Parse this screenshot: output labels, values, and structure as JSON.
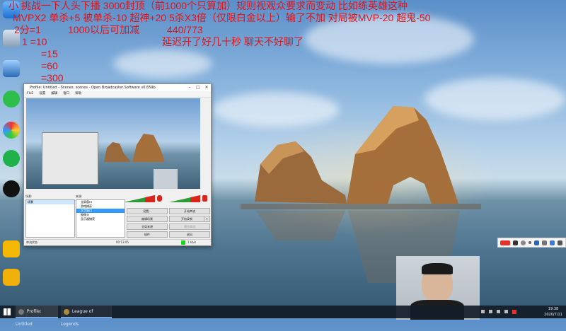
{
  "overlay": {
    "line1": "小 挑战一下人头下播 3000封顶（前1000个只算加）规则视观众要求而变动 比如练英雄这种",
    "line2": "MVPX2 单杀+5 被单杀-10 超神+20 5杀X3倍（仅限白金以上）输了不加 对局被MVP-20 超鬼-50",
    "line3a": "2分=1",
    "line3b": "1000以后可加减",
    "line3c": "440/773",
    "line4a": "1 =10",
    "line4b": "延迟开了好几十秒 聊天不好聊了",
    "line5": "=15",
    "line6": "=60",
    "line7": "=300"
  },
  "obs": {
    "title": "Profile: Untitled - Scenes: scenes - Open Broadcaster Software v0.659b",
    "menu": [
      "FILE",
      "设置",
      "编辑",
      "窗口",
      "帮助"
    ],
    "scenes_label": "场景:",
    "sources_label": "来源:",
    "scene_item": "场景",
    "sources": [
      "全屏窗口",
      "游戏捕获",
      "文字窗口",
      "摄像头",
      "显示器捕获"
    ],
    "buttons": {
      "settings": "设置...",
      "start_stream": "开始串流",
      "edit_scene": "编辑场景",
      "start_record": "开始录制",
      "global_sources": "全局来源",
      "preview": "预览串流",
      "plugins": "插件",
      "exit": "退出"
    },
    "status_left": "串流状态",
    "status_mid": "00:13:05",
    "status_right": "1 kb/s"
  },
  "taskbar": {
    "start_icon": "windows-logo-icon",
    "items": [
      {
        "label": "Profile: Untitled",
        "icon": "obs-icon"
      },
      {
        "label": "League of Legends",
        "icon": "lol-icon"
      }
    ],
    "clock_time": "19:38",
    "clock_date": "2020/7/11"
  },
  "desktop_icons": [
    "computer-icon",
    "recycle-bin-icon",
    "chat-icon",
    "qq-icon",
    "game-icon",
    "app-icon"
  ],
  "ime_icons": [
    "sogou-icon",
    "lang-icon",
    "moon-icon",
    "dot-icon",
    "mic-icon",
    "keyboard-icon",
    "shirt-icon",
    "grid-icon"
  ]
}
